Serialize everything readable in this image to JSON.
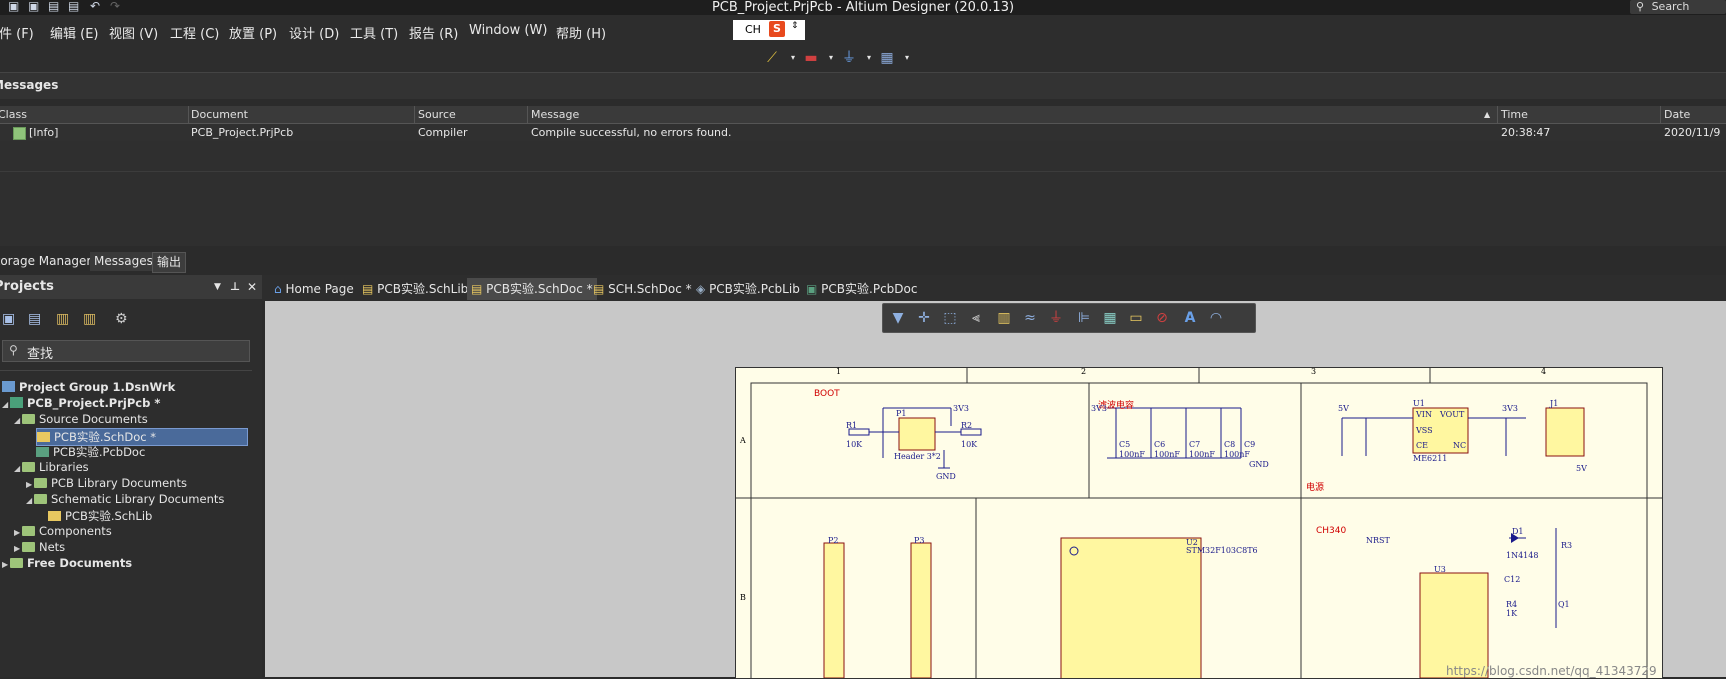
{
  "window": {
    "title": "PCB_Project.PrjPcb - Altium Designer (20.0.13)",
    "search_label": "Search"
  },
  "menu": [
    "文件 (F)",
    "编辑 (E)",
    "视图 (V)",
    "工程 (C)",
    "放置 (P)",
    "设计 (D)",
    "工具 (T)",
    "报告 (R)",
    "Window (W)",
    "帮助 (H)"
  ],
  "ime": {
    "label": "CH",
    "badge": "S"
  },
  "messages": {
    "panel_title": "Messages",
    "columns": [
      "Class",
      "Document",
      "Source",
      "Message",
      "Time",
      "Date"
    ],
    "rows": [
      {
        "class": "[Info]",
        "document": "PCB_Project.PrjPcb",
        "source": "Compiler",
        "message": "Compile successful, no errors found.",
        "time": "20:38:47",
        "date": "2020/11/9"
      }
    ]
  },
  "panel_tabs": [
    "Storage Manager",
    "Messages",
    "输出"
  ],
  "projects": {
    "title": "Projects",
    "search_placeholder": "查找",
    "tree": [
      {
        "label": "Project Group 1.DsnWrk",
        "level": 0,
        "bold": true
      },
      {
        "label": "PCB_Project.PrjPcb *",
        "level": 0,
        "bold": true
      },
      {
        "label": "Source Documents",
        "level": 1
      },
      {
        "label": "PCB实验.SchDoc *",
        "level": 2,
        "selected": true
      },
      {
        "label": "PCB实验.PcbDoc",
        "level": 2
      },
      {
        "label": "Libraries",
        "level": 1
      },
      {
        "label": "PCB Library Documents",
        "level": 2
      },
      {
        "label": "Schematic Library Documents",
        "level": 2
      },
      {
        "label": "PCB实验.SchLib",
        "level": 3
      },
      {
        "label": "Components",
        "level": 1
      },
      {
        "label": "Nets",
        "level": 1
      },
      {
        "label": "Free Documents",
        "level": 0,
        "bold": true
      }
    ]
  },
  "doc_tabs": [
    "Home Page",
    "PCB实验.SchLib",
    "PCB实验.SchDoc *",
    "SCH.SchDoc *",
    "PCB实验.PcbLib",
    "PCB实验.PcbDoc"
  ],
  "schematic": {
    "zone_numbers": [
      "1",
      "2",
      "3",
      "4"
    ],
    "zone_letters": [
      "A",
      "B"
    ],
    "section_boot": "BOOT",
    "section_filter": "滤波电容",
    "section_power": "电源",
    "section_ch340": "CH340",
    "labels": {
      "r1": "R1",
      "r1_val": "10K",
      "r2": "R2",
      "r2_val": "10K",
      "p1": "P1",
      "p1_type": "Header 3*2",
      "v3v3": "3V3",
      "gnd": "GND",
      "v5v": "5V",
      "c5": "C5",
      "c6": "C6",
      "c7": "C7",
      "c8": "C8",
      "c9": "C9",
      "cap100n": "100nF",
      "u1": "U1",
      "u1_part": "ME6211",
      "vin": "VIN",
      "vout": "VOUT",
      "vss": "VSS",
      "ce": "CE",
      "nc": "NC",
      "j1": "J1",
      "u2": "U2",
      "u2_part": "STM32F103C8T6",
      "u3": "U3",
      "p2": "P2",
      "p3": "P3",
      "nrst": "NRST",
      "d1": "D1",
      "d1_part": "1N4148",
      "r3": "R3",
      "q1": "Q1",
      "c12": "C12",
      "r4": "R4",
      "r4_val": "1K",
      "watermark": "https://blog.csdn.net/qq_41343729"
    }
  }
}
